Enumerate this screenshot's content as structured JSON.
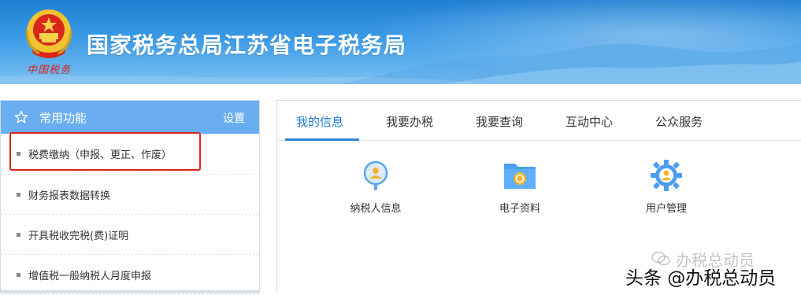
{
  "banner": {
    "title": "国家税务总局江苏省电子税务局",
    "emblem_caption": "中国税务",
    "emblem_icon": "national-emblem-icon"
  },
  "left_panel": {
    "title": "常用功能",
    "settings_label": "设置",
    "items": [
      {
        "label": "税费缴纳（申报、更正、作废）"
      },
      {
        "label": "财务报表数据转换"
      },
      {
        "label": "开具税收完税(费)证明"
      },
      {
        "label": "增值税一般纳税人月度申报"
      }
    ]
  },
  "right_panel": {
    "tabs": [
      {
        "label": "我的信息",
        "active": true
      },
      {
        "label": "我要办税",
        "active": false
      },
      {
        "label": "我要查询",
        "active": false
      },
      {
        "label": "互动中心",
        "active": false
      },
      {
        "label": "公众服务",
        "active": false
      }
    ],
    "quick_links": [
      {
        "label": "纳税人信息",
        "icon": "taxpayer-search-icon"
      },
      {
        "label": "电子资料",
        "icon": "folder-icon"
      },
      {
        "label": "用户管理",
        "icon": "gear-user-icon"
      }
    ]
  },
  "watermark": {
    "text": "头条 @办税总动员",
    "faded_text": "办税总动员"
  },
  "colors": {
    "banner_blue": "#1f7fd2",
    "header_blue": "#69aef0",
    "active_tab": "#1f7bd6",
    "highlight_red": "#d9261c"
  }
}
